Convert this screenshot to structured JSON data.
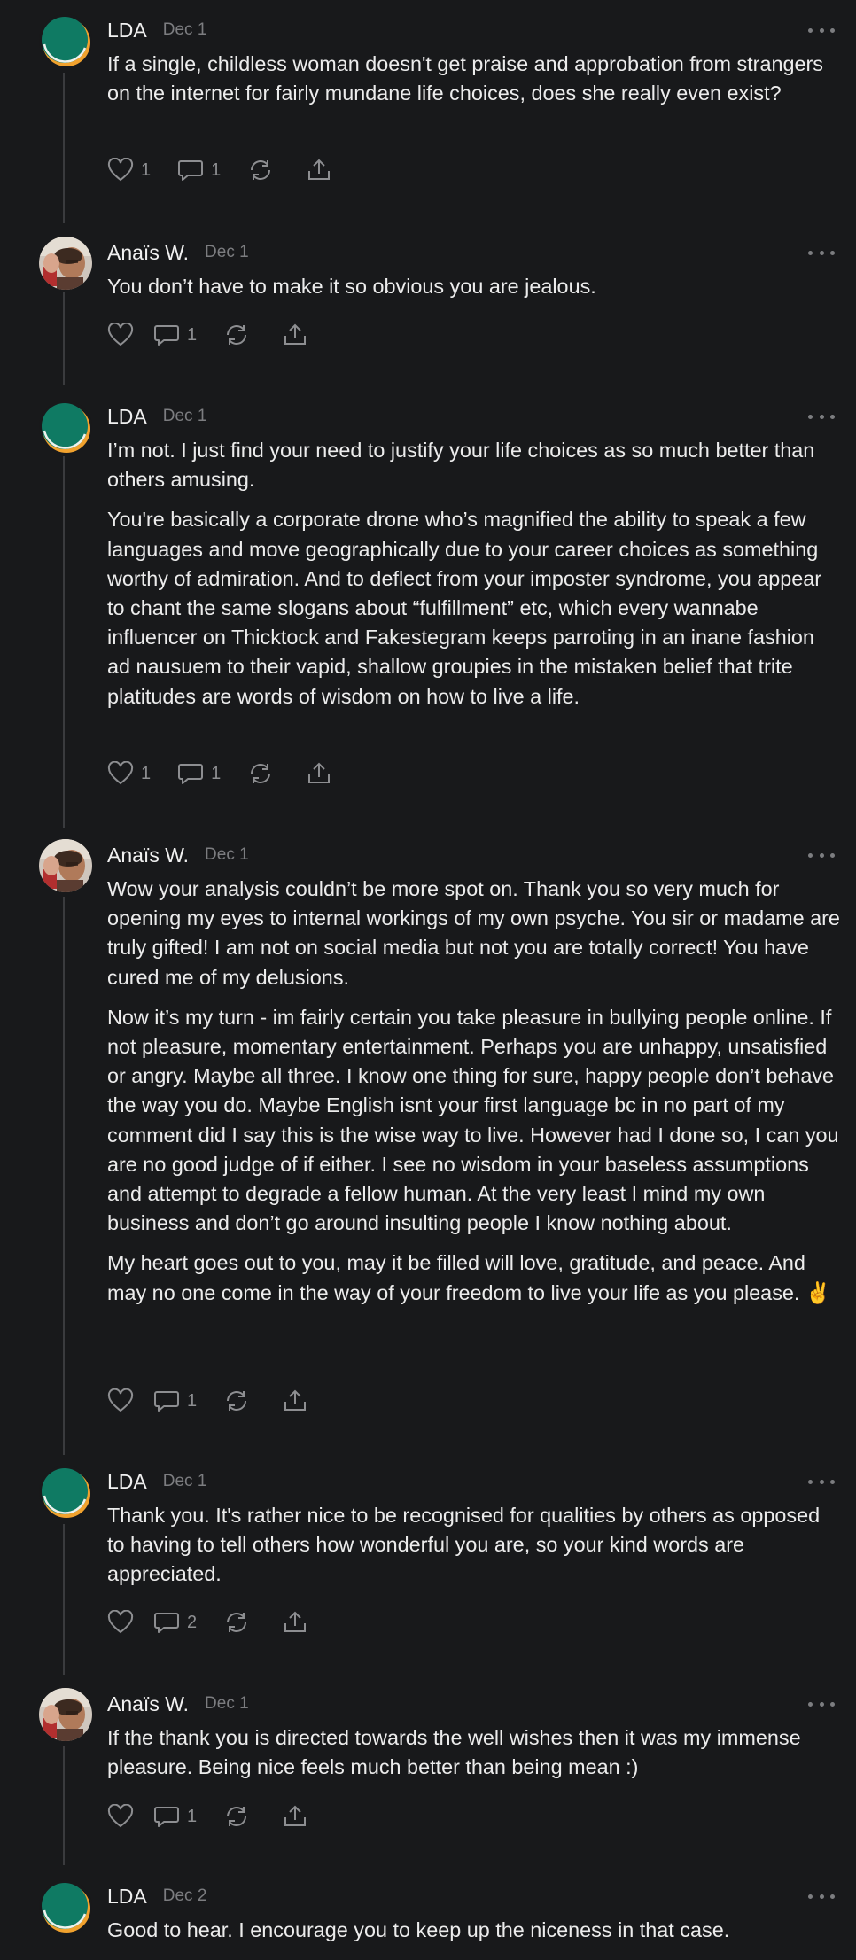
{
  "avatars": {
    "lda": "teal-orange-circle-avatar",
    "anais": "profile-photo-avatar"
  },
  "colors": {
    "background": "#18191b",
    "text": "#ececec",
    "muted": "#7c7d80",
    "lda_teal": "#0f7a63",
    "lda_orange": "#f1a22e"
  },
  "comments": [
    {
      "author": "LDA",
      "date": "Dec 1",
      "paragraphs": [
        "If a single, childless woman doesn't get praise and approbation from strangers on the internet for fairly mundane life choices, does she really even exist?"
      ],
      "likes": "1",
      "replies": "1"
    },
    {
      "author": "Anaïs W.",
      "date": "Dec 1",
      "paragraphs": [
        "You don’t have to make it so obvious you are jealous."
      ],
      "likes": "",
      "replies": "1"
    },
    {
      "author": "LDA",
      "date": "Dec 1",
      "paragraphs": [
        "I’m not. I just find your need to justify your life choices as so much better than others amusing.",
        "You're basically a corporate drone who’s magnified the ability to speak a few languages and move geographically due to your career choices as something worthy of admiration. And to deflect from your imposter syndrome, you appear to chant the same slogans about “fulfillment” etc, which every wannabe influencer on Thicktock and Fakestegram keeps parroting in an inane fashion ad nausuem to their vapid, shallow groupies in the mistaken belief that trite platitudes are words of wisdom on how to live a life."
      ],
      "likes": "1",
      "replies": "1"
    },
    {
      "author": "Anaïs W.",
      "date": "Dec 1",
      "paragraphs": [
        "Wow your analysis couldn’t be more spot on. Thank you so very much for opening my eyes to internal workings of my own psyche. You sir or madame are truly gifted! I am not on social media but not you are totally correct! You have cured me of my delusions.",
        "Now it’s my turn - im fairly certain you take pleasure in bullying people online. If not pleasure, momentary entertainment. Perhaps you are unhappy, unsatisfied or angry. Maybe all three. I know one thing for sure, happy people don’t behave the way you do. Maybe English isnt your first language bc in no part of my comment did I say this is the wise way to live. However had I done so, I can you are no good judge of if either. I see no wisdom in your baseless assumptions and attempt to degrade a fellow human. At the very least I mind my own business and don’t go around insulting people I know nothing about.",
        "My heart goes out to you, may it be filled will love, gratitude, and peace. And may no one come in the way of your freedom to live your life as you please. ✌️"
      ],
      "likes": "",
      "replies": "1"
    },
    {
      "author": "LDA",
      "date": "Dec 1",
      "paragraphs": [
        "Thank you. It's rather nice to be recognised for qualities by others as opposed to having to tell others how wonderful you are, so your kind words are appreciated."
      ],
      "likes": "",
      "replies": "2"
    },
    {
      "author": "Anaïs W.",
      "date": "Dec 1",
      "paragraphs": [
        "If the thank you is directed towards the well wishes then it was my immense pleasure. Being nice feels much better than being mean :)"
      ],
      "likes": "",
      "replies": "1"
    },
    {
      "author": "LDA",
      "date": "Dec 2",
      "paragraphs": [
        "Good to hear. I encourage you to keep up the niceness in that case."
      ],
      "likes": "",
      "replies": ""
    }
  ]
}
